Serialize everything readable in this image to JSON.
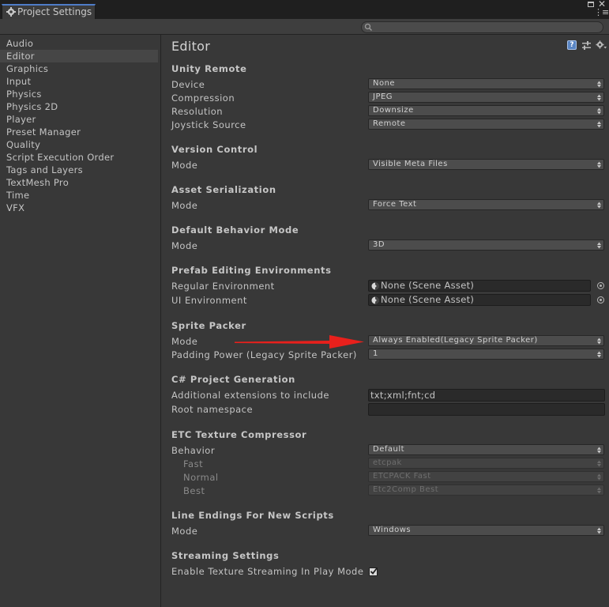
{
  "window": {
    "tab_title": "Project Settings"
  },
  "search": {
    "placeholder": ""
  },
  "sidebar": {
    "items": [
      {
        "label": "Audio"
      },
      {
        "label": "Editor"
      },
      {
        "label": "Graphics"
      },
      {
        "label": "Input"
      },
      {
        "label": "Physics"
      },
      {
        "label": "Physics 2D"
      },
      {
        "label": "Player"
      },
      {
        "label": "Preset Manager"
      },
      {
        "label": "Quality"
      },
      {
        "label": "Script Execution Order"
      },
      {
        "label": "Tags and Layers"
      },
      {
        "label": "TextMesh Pro"
      },
      {
        "label": "Time"
      },
      {
        "label": "VFX"
      }
    ],
    "selected": "Editor"
  },
  "main": {
    "title": "Editor",
    "unity_remote": {
      "header": "Unity Remote",
      "device_label": "Device",
      "device_value": "None",
      "compression_label": "Compression",
      "compression_value": "JPEG",
      "resolution_label": "Resolution",
      "resolution_value": "Downsize",
      "joystick_label": "Joystick Source",
      "joystick_value": "Remote"
    },
    "version_control": {
      "header": "Version Control",
      "mode_label": "Mode",
      "mode_value": "Visible Meta Files"
    },
    "asset_serialization": {
      "header": "Asset Serialization",
      "mode_label": "Mode",
      "mode_value": "Force Text"
    },
    "default_behavior": {
      "header": "Default Behavior Mode",
      "mode_label": "Mode",
      "mode_value": "3D"
    },
    "prefab_editing": {
      "header": "Prefab Editing Environments",
      "regular_label": "Regular Environment",
      "regular_value": "None (Scene Asset)",
      "ui_label": "UI Environment",
      "ui_value": "None (Scene Asset)"
    },
    "sprite_packer": {
      "header": "Sprite Packer",
      "mode_label": "Mode",
      "mode_value": "Always Enabled(Legacy Sprite Packer)",
      "padding_label": "Padding Power (Legacy Sprite Packer)",
      "padding_value": "1"
    },
    "csharp_generation": {
      "header": "C# Project Generation",
      "extensions_label": "Additional extensions to include",
      "extensions_value": "txt;xml;fnt;cd",
      "namespace_label": "Root namespace",
      "namespace_value": ""
    },
    "etc_compressor": {
      "header": "ETC Texture Compressor",
      "behavior_label": "Behavior",
      "behavior_value": "Default",
      "fast_label": "Fast",
      "fast_value": "etcpak",
      "normal_label": "Normal",
      "normal_value": "ETCPACK Fast",
      "best_label": "Best",
      "best_value": "Etc2Comp Best"
    },
    "line_endings": {
      "header": "Line Endings For New Scripts",
      "mode_label": "Mode",
      "mode_value": "Windows"
    },
    "streaming": {
      "header": "Streaming Settings",
      "enable_label": "Enable Texture Streaming In Play Mode",
      "enable_checked": true
    }
  },
  "colors": {
    "background": "#383838",
    "annotation_arrow": "#e8201c",
    "tab_accent": "#4e7cc7"
  }
}
